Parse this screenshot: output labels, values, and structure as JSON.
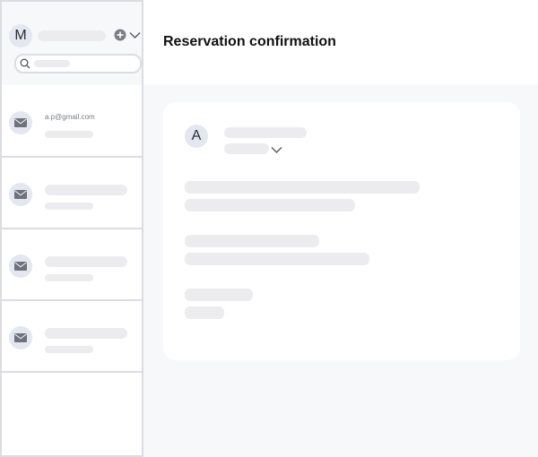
{
  "account": {
    "avatar_letter": "M"
  },
  "message_list": [
    {
      "from": "a.p@gmail.com",
      "icon": "envelope-icon"
    },
    {
      "from": "",
      "icon": "envelope-icon"
    },
    {
      "from": "",
      "icon": "envelope-icon"
    },
    {
      "from": "",
      "icon": "envelope-icon"
    }
  ],
  "message": {
    "subject": "Reservation confirmation",
    "sender_avatar_letter": "A"
  },
  "colors": {
    "placeholder": "#ececee",
    "border": "#dcdde2",
    "avatar_bg": "#e3e7ef",
    "page_bg": "#f7f8fa"
  }
}
